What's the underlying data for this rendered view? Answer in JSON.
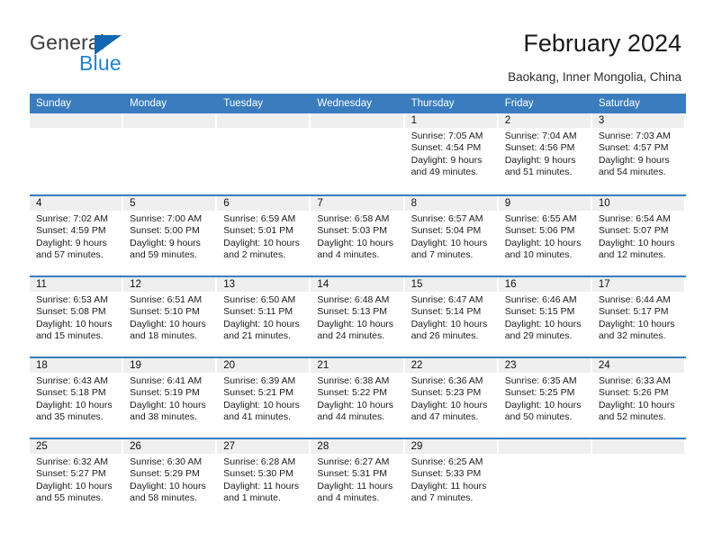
{
  "brand": {
    "name_top": "General",
    "name_bottom": "Blue",
    "accent_color": "#2083d4",
    "triangle_color": "#1267b2"
  },
  "header": {
    "title": "February 2024",
    "subtitle": "Baokang, Inner Mongolia, China"
  },
  "calendar": {
    "header_color": "#3a7cbe",
    "day_band_color": "#efefef",
    "weekdays": [
      "Sunday",
      "Monday",
      "Tuesday",
      "Wednesday",
      "Thursday",
      "Friday",
      "Saturday"
    ],
    "weeks": [
      [
        {
          "date": "",
          "empty": true
        },
        {
          "date": "",
          "empty": true
        },
        {
          "date": "",
          "empty": true
        },
        {
          "date": "",
          "empty": true
        },
        {
          "date": "1",
          "sunrise": "Sunrise: 7:05 AM",
          "sunset": "Sunset: 4:54 PM",
          "daylight_1": "Daylight: 9 hours",
          "daylight_2": "and 49 minutes."
        },
        {
          "date": "2",
          "sunrise": "Sunrise: 7:04 AM",
          "sunset": "Sunset: 4:56 PM",
          "daylight_1": "Daylight: 9 hours",
          "daylight_2": "and 51 minutes."
        },
        {
          "date": "3",
          "sunrise": "Sunrise: 7:03 AM",
          "sunset": "Sunset: 4:57 PM",
          "daylight_1": "Daylight: 9 hours",
          "daylight_2": "and 54 minutes."
        }
      ],
      [
        {
          "date": "4",
          "sunrise": "Sunrise: 7:02 AM",
          "sunset": "Sunset: 4:59 PM",
          "daylight_1": "Daylight: 9 hours",
          "daylight_2": "and 57 minutes."
        },
        {
          "date": "5",
          "sunrise": "Sunrise: 7:00 AM",
          "sunset": "Sunset: 5:00 PM",
          "daylight_1": "Daylight: 9 hours",
          "daylight_2": "and 59 minutes."
        },
        {
          "date": "6",
          "sunrise": "Sunrise: 6:59 AM",
          "sunset": "Sunset: 5:01 PM",
          "daylight_1": "Daylight: 10 hours",
          "daylight_2": "and 2 minutes."
        },
        {
          "date": "7",
          "sunrise": "Sunrise: 6:58 AM",
          "sunset": "Sunset: 5:03 PM",
          "daylight_1": "Daylight: 10 hours",
          "daylight_2": "and 4 minutes."
        },
        {
          "date": "8",
          "sunrise": "Sunrise: 6:57 AM",
          "sunset": "Sunset: 5:04 PM",
          "daylight_1": "Daylight: 10 hours",
          "daylight_2": "and 7 minutes."
        },
        {
          "date": "9",
          "sunrise": "Sunrise: 6:55 AM",
          "sunset": "Sunset: 5:06 PM",
          "daylight_1": "Daylight: 10 hours",
          "daylight_2": "and 10 minutes."
        },
        {
          "date": "10",
          "sunrise": "Sunrise: 6:54 AM",
          "sunset": "Sunset: 5:07 PM",
          "daylight_1": "Daylight: 10 hours",
          "daylight_2": "and 12 minutes."
        }
      ],
      [
        {
          "date": "11",
          "sunrise": "Sunrise: 6:53 AM",
          "sunset": "Sunset: 5:08 PM",
          "daylight_1": "Daylight: 10 hours",
          "daylight_2": "and 15 minutes."
        },
        {
          "date": "12",
          "sunrise": "Sunrise: 6:51 AM",
          "sunset": "Sunset: 5:10 PM",
          "daylight_1": "Daylight: 10 hours",
          "daylight_2": "and 18 minutes."
        },
        {
          "date": "13",
          "sunrise": "Sunrise: 6:50 AM",
          "sunset": "Sunset: 5:11 PM",
          "daylight_1": "Daylight: 10 hours",
          "daylight_2": "and 21 minutes."
        },
        {
          "date": "14",
          "sunrise": "Sunrise: 6:48 AM",
          "sunset": "Sunset: 5:13 PM",
          "daylight_1": "Daylight: 10 hours",
          "daylight_2": "and 24 minutes."
        },
        {
          "date": "15",
          "sunrise": "Sunrise: 6:47 AM",
          "sunset": "Sunset: 5:14 PM",
          "daylight_1": "Daylight: 10 hours",
          "daylight_2": "and 26 minutes."
        },
        {
          "date": "16",
          "sunrise": "Sunrise: 6:46 AM",
          "sunset": "Sunset: 5:15 PM",
          "daylight_1": "Daylight: 10 hours",
          "daylight_2": "and 29 minutes."
        },
        {
          "date": "17",
          "sunrise": "Sunrise: 6:44 AM",
          "sunset": "Sunset: 5:17 PM",
          "daylight_1": "Daylight: 10 hours",
          "daylight_2": "and 32 minutes."
        }
      ],
      [
        {
          "date": "18",
          "sunrise": "Sunrise: 6:43 AM",
          "sunset": "Sunset: 5:18 PM",
          "daylight_1": "Daylight: 10 hours",
          "daylight_2": "and 35 minutes."
        },
        {
          "date": "19",
          "sunrise": "Sunrise: 6:41 AM",
          "sunset": "Sunset: 5:19 PM",
          "daylight_1": "Daylight: 10 hours",
          "daylight_2": "and 38 minutes."
        },
        {
          "date": "20",
          "sunrise": "Sunrise: 6:39 AM",
          "sunset": "Sunset: 5:21 PM",
          "daylight_1": "Daylight: 10 hours",
          "daylight_2": "and 41 minutes."
        },
        {
          "date": "21",
          "sunrise": "Sunrise: 6:38 AM",
          "sunset": "Sunset: 5:22 PM",
          "daylight_1": "Daylight: 10 hours",
          "daylight_2": "and 44 minutes."
        },
        {
          "date": "22",
          "sunrise": "Sunrise: 6:36 AM",
          "sunset": "Sunset: 5:23 PM",
          "daylight_1": "Daylight: 10 hours",
          "daylight_2": "and 47 minutes."
        },
        {
          "date": "23",
          "sunrise": "Sunrise: 6:35 AM",
          "sunset": "Sunset: 5:25 PM",
          "daylight_1": "Daylight: 10 hours",
          "daylight_2": "and 50 minutes."
        },
        {
          "date": "24",
          "sunrise": "Sunrise: 6:33 AM",
          "sunset": "Sunset: 5:26 PM",
          "daylight_1": "Daylight: 10 hours",
          "daylight_2": "and 52 minutes."
        }
      ],
      [
        {
          "date": "25",
          "sunrise": "Sunrise: 6:32 AM",
          "sunset": "Sunset: 5:27 PM",
          "daylight_1": "Daylight: 10 hours",
          "daylight_2": "and 55 minutes."
        },
        {
          "date": "26",
          "sunrise": "Sunrise: 6:30 AM",
          "sunset": "Sunset: 5:29 PM",
          "daylight_1": "Daylight: 10 hours",
          "daylight_2": "and 58 minutes."
        },
        {
          "date": "27",
          "sunrise": "Sunrise: 6:28 AM",
          "sunset": "Sunset: 5:30 PM",
          "daylight_1": "Daylight: 11 hours",
          "daylight_2": "and 1 minute."
        },
        {
          "date": "28",
          "sunrise": "Sunrise: 6:27 AM",
          "sunset": "Sunset: 5:31 PM",
          "daylight_1": "Daylight: 11 hours",
          "daylight_2": "and 4 minutes."
        },
        {
          "date": "29",
          "sunrise": "Sunrise: 6:25 AM",
          "sunset": "Sunset: 5:33 PM",
          "daylight_1": "Daylight: 11 hours",
          "daylight_2": "and 7 minutes."
        },
        {
          "date": "",
          "empty": true
        },
        {
          "date": "",
          "empty": true
        }
      ]
    ]
  }
}
